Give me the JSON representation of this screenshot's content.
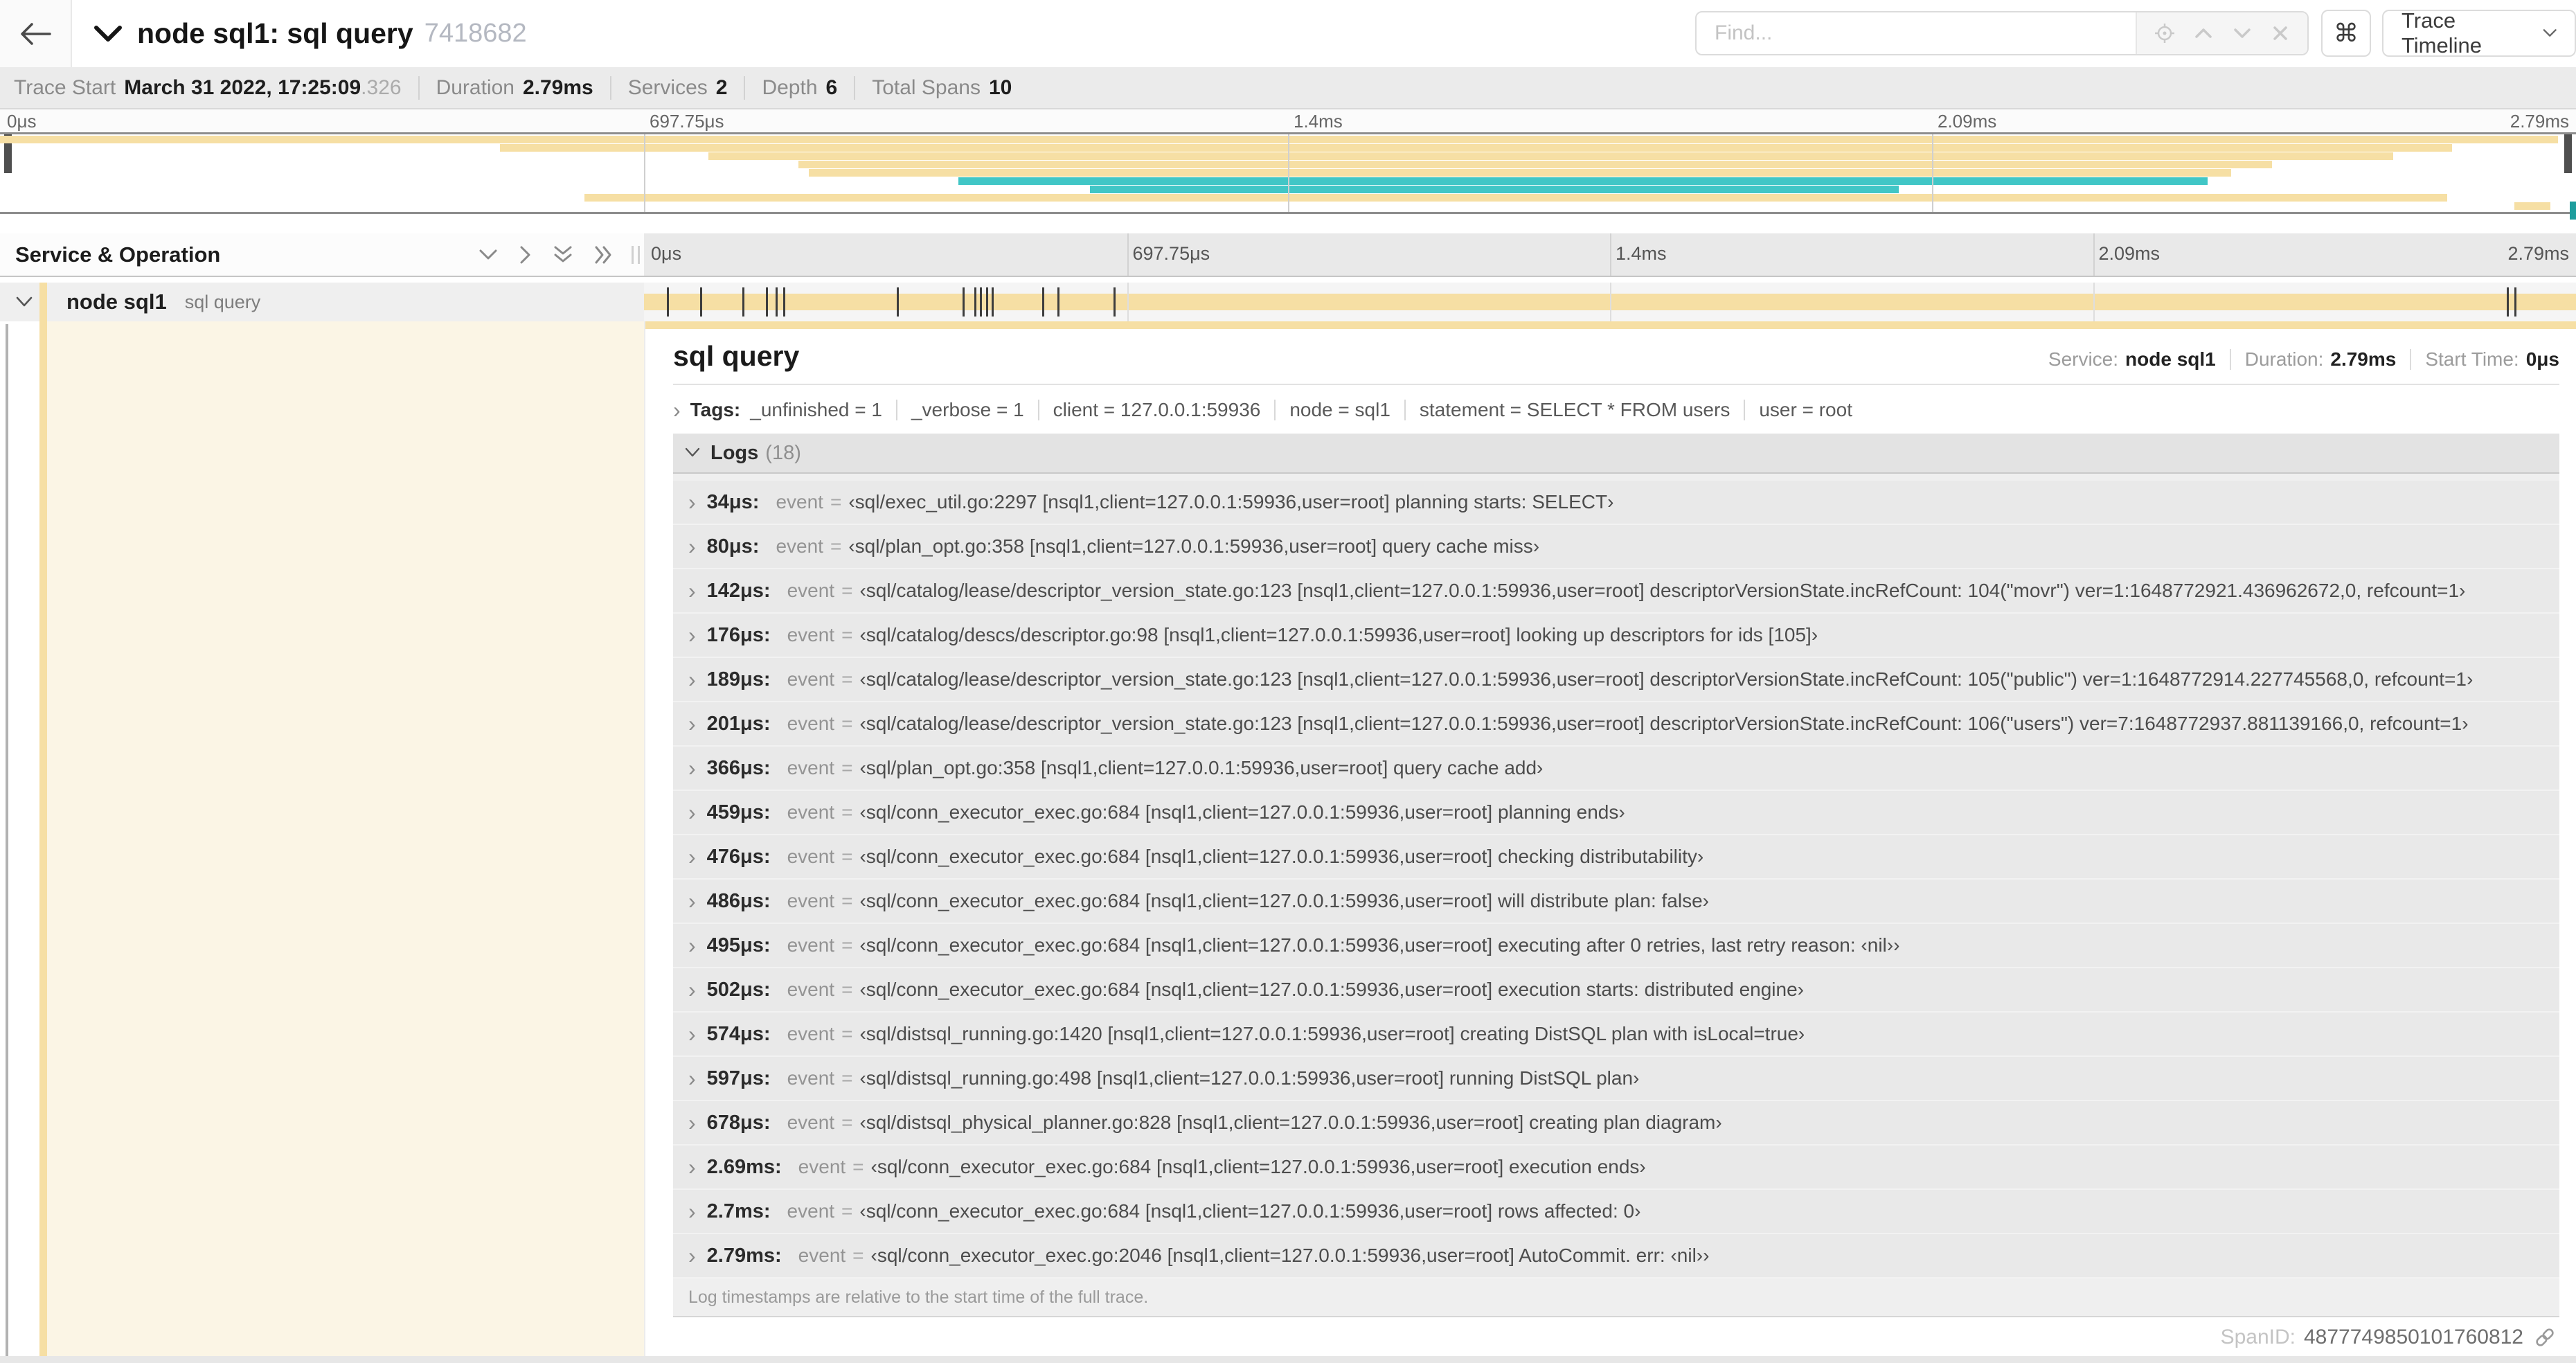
{
  "colors": {
    "span": "#f6dfa4",
    "span_light": "#fbf5e5",
    "teal": "#41c6c6",
    "marker": "#3d3d3d"
  },
  "header": {
    "title": "node sql1: sql query",
    "trace_id": "7418682",
    "find_placeholder": "Find...",
    "command_symbol": "⌘",
    "view_dropdown": "Trace Timeline"
  },
  "summary": {
    "trace_start_label": "Trace Start",
    "trace_start_value": "March 31 2022, 17:25:09",
    "trace_start_frac": ".326",
    "duration_label": "Duration",
    "duration_value": "2.79ms",
    "services_label": "Services",
    "services_value": "2",
    "depth_label": "Depth",
    "depth_value": "6",
    "total_spans_label": "Total Spans",
    "total_spans_value": "10"
  },
  "minimap": {
    "rows": [
      {
        "row": 0,
        "start": 0,
        "end": 99.3,
        "color": "span"
      },
      {
        "row": 1,
        "start": 19.4,
        "end": 95.2,
        "color": "span"
      },
      {
        "row": 2,
        "start": 27.5,
        "end": 92.9,
        "color": "span"
      },
      {
        "row": 3,
        "start": 31.0,
        "end": 88.2,
        "color": "span"
      },
      {
        "row": 4,
        "start": 31.4,
        "end": 86.6,
        "color": "span"
      },
      {
        "row": 5,
        "start": 37.2,
        "end": 85.7,
        "color": "teal"
      },
      {
        "row": 6,
        "start": 42.3,
        "end": 73.7,
        "color": "teal"
      },
      {
        "row": 7,
        "start": 22.7,
        "end": 95.0,
        "color": "span"
      },
      {
        "row": 8,
        "start": 97.6,
        "end": 99.0,
        "color": "span"
      }
    ]
  },
  "timeline": {
    "columns_title": "Service & Operation",
    "ticks": [
      {
        "label": "0μs",
        "pos": 0
      },
      {
        "label": "697.75μs",
        "pos": 25
      },
      {
        "label": "1.4ms",
        "pos": 50
      },
      {
        "label": "2.09ms",
        "pos": 75
      },
      {
        "label": "2.79ms",
        "pos": 100
      }
    ],
    "log_marker_positions": [
      1.2,
      2.9,
      5.1,
      6.3,
      6.8,
      7.2,
      13.1,
      16.5,
      17.1,
      17.4,
      17.7,
      18.0,
      20.6,
      21.4,
      24.3,
      96.4,
      96.8
    ],
    "row": {
      "service": "node sql1",
      "operation": "sql query"
    }
  },
  "detail": {
    "operation": "sql query",
    "service_label": "Service:",
    "service": "node sql1",
    "duration_label": "Duration:",
    "duration": "2.79ms",
    "start_label": "Start Time:",
    "start": "0μs",
    "tags_label": "Tags:",
    "tags": [
      {
        "key": "_unfinished",
        "value": "1"
      },
      {
        "key": "_verbose",
        "value": "1"
      },
      {
        "key": "client",
        "value": "127.0.0.1:59936"
      },
      {
        "key": "node",
        "value": "sql1"
      },
      {
        "key": "statement",
        "value": "SELECT * FROM users"
      },
      {
        "key": "user",
        "value": "root"
      }
    ],
    "logs_label": "Logs",
    "logs_count": "(18)",
    "logs": [
      {
        "time": "34μs:",
        "key": "event",
        "value": "‹sql/exec_util.go:2297 [nsql1,client=127.0.0.1:59936,user=root] planning starts: SELECT›"
      },
      {
        "time": "80μs:",
        "key": "event",
        "value": "‹sql/plan_opt.go:358 [nsql1,client=127.0.0.1:59936,user=root] query cache miss›"
      },
      {
        "time": "142μs:",
        "key": "event",
        "value": "‹sql/catalog/lease/descriptor_version_state.go:123 [nsql1,client=127.0.0.1:59936,user=root] descriptorVersionState.incRefCount: 104(\"movr\") ver=1:1648772921.436962672,0, refcount=1›"
      },
      {
        "time": "176μs:",
        "key": "event",
        "value": "‹sql/catalog/descs/descriptor.go:98 [nsql1,client=127.0.0.1:59936,user=root] looking up descriptors for ids [105]›"
      },
      {
        "time": "189μs:",
        "key": "event",
        "value": "‹sql/catalog/lease/descriptor_version_state.go:123 [nsql1,client=127.0.0.1:59936,user=root] descriptorVersionState.incRefCount: 105(\"public\") ver=1:1648772914.227745568,0, refcount=1›"
      },
      {
        "time": "201μs:",
        "key": "event",
        "value": "‹sql/catalog/lease/descriptor_version_state.go:123 [nsql1,client=127.0.0.1:59936,user=root] descriptorVersionState.incRefCount: 106(\"users\") ver=7:1648772937.881139166,0, refcount=1›"
      },
      {
        "time": "366μs:",
        "key": "event",
        "value": "‹sql/plan_opt.go:358 [nsql1,client=127.0.0.1:59936,user=root] query cache add›"
      },
      {
        "time": "459μs:",
        "key": "event",
        "value": "‹sql/conn_executor_exec.go:684 [nsql1,client=127.0.0.1:59936,user=root] planning ends›"
      },
      {
        "time": "476μs:",
        "key": "event",
        "value": "‹sql/conn_executor_exec.go:684 [nsql1,client=127.0.0.1:59936,user=root] checking distributability›"
      },
      {
        "time": "486μs:",
        "key": "event",
        "value": "‹sql/conn_executor_exec.go:684 [nsql1,client=127.0.0.1:59936,user=root] will distribute plan: false›"
      },
      {
        "time": "495μs:",
        "key": "event",
        "value": "‹sql/conn_executor_exec.go:684 [nsql1,client=127.0.0.1:59936,user=root] executing after 0 retries, last retry reason: ‹nil››"
      },
      {
        "time": "502μs:",
        "key": "event",
        "value": "‹sql/conn_executor_exec.go:684 [nsql1,client=127.0.0.1:59936,user=root] execution starts: distributed engine›"
      },
      {
        "time": "574μs:",
        "key": "event",
        "value": "‹sql/distsql_running.go:1420 [nsql1,client=127.0.0.1:59936,user=root] creating DistSQL plan with isLocal=true›"
      },
      {
        "time": "597μs:",
        "key": "event",
        "value": "‹sql/distsql_running.go:498 [nsql1,client=127.0.0.1:59936,user=root] running DistSQL plan›"
      },
      {
        "time": "678μs:",
        "key": "event",
        "value": "‹sql/distsql_physical_planner.go:828 [nsql1,client=127.0.0.1:59936,user=root] creating plan diagram›"
      },
      {
        "time": "2.69ms:",
        "key": "event",
        "value": "‹sql/conn_executor_exec.go:684 [nsql1,client=127.0.0.1:59936,user=root] execution ends›"
      },
      {
        "time": "2.7ms:",
        "key": "event",
        "value": "‹sql/conn_executor_exec.go:684 [nsql1,client=127.0.0.1:59936,user=root] rows affected: 0›"
      },
      {
        "time": "2.79ms:",
        "key": "event",
        "value": "‹sql/conn_executor_exec.go:2046 [nsql1,client=127.0.0.1:59936,user=root] AutoCommit. err: ‹nil››"
      }
    ],
    "logs_note": "Log timestamps are relative to the start time of the full trace.",
    "spanid_label": "SpanID:",
    "spanid": "4877749850101760812"
  }
}
